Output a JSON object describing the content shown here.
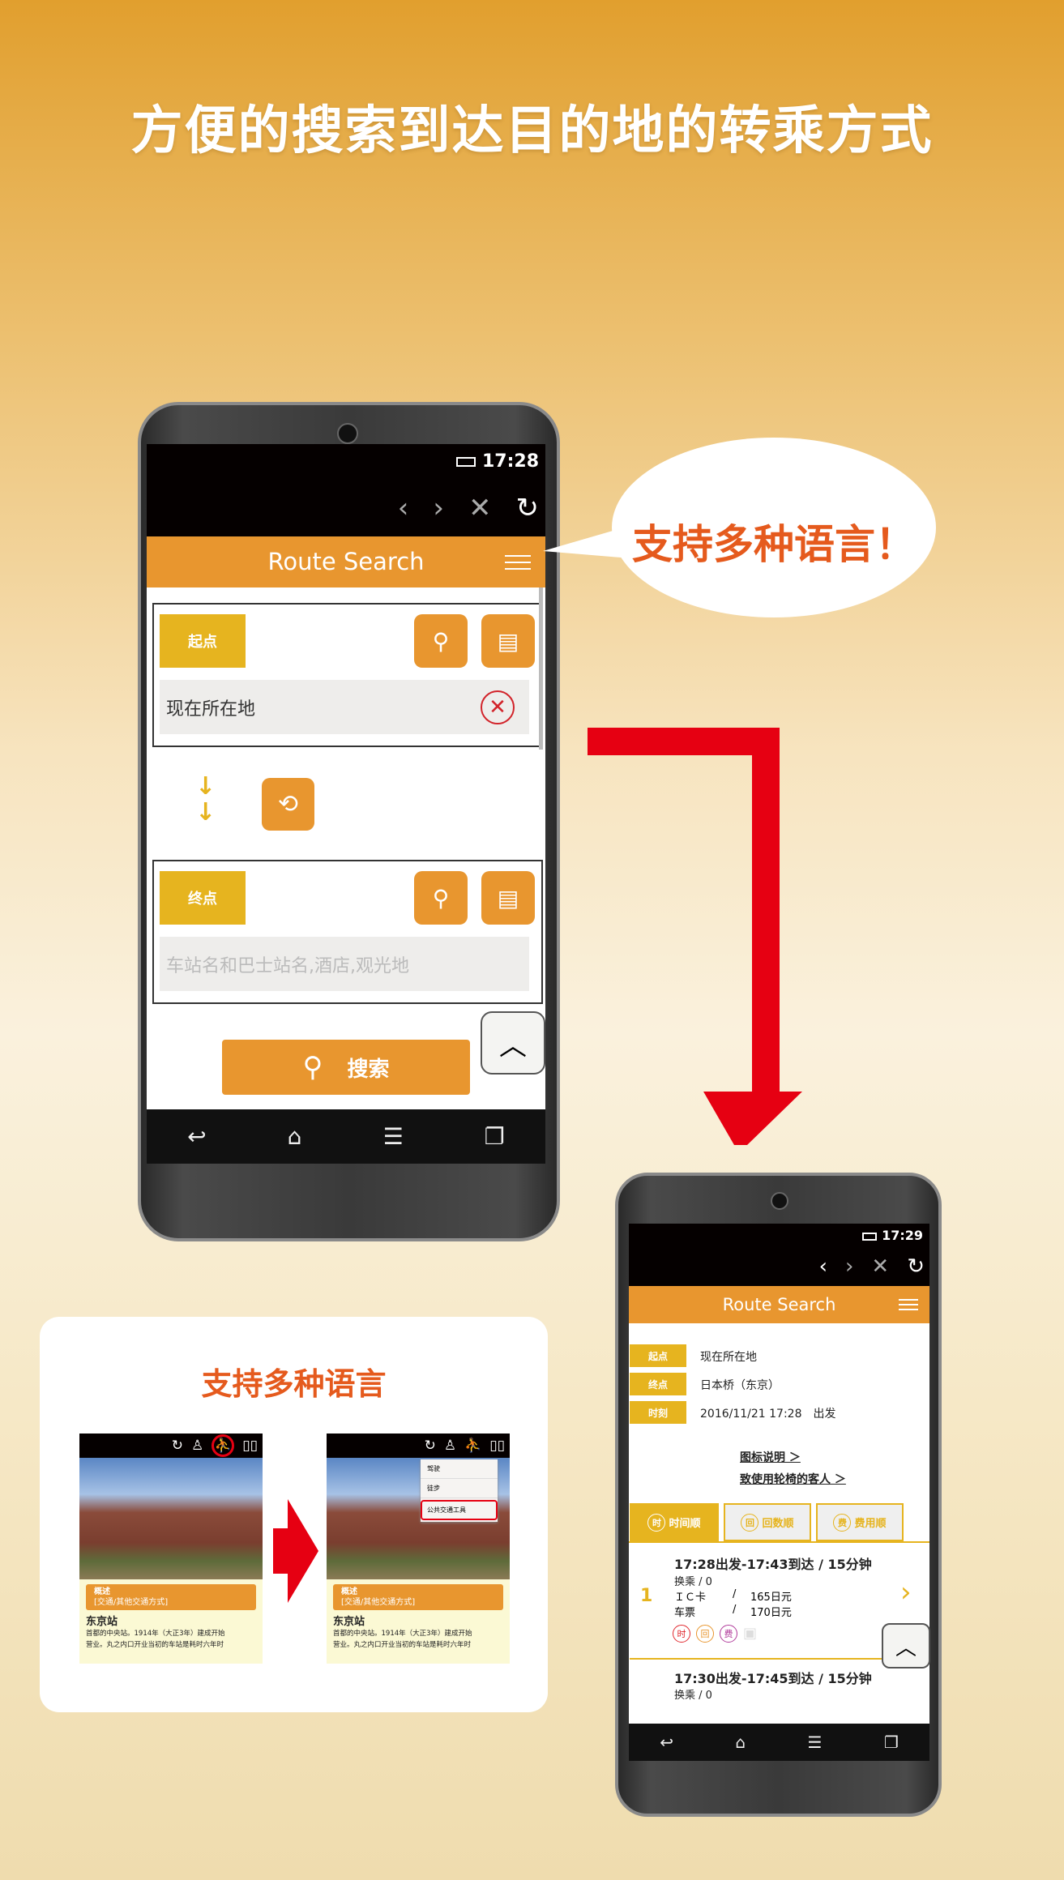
{
  "headline": "方便的搜索到达目的地的转乘方式",
  "callout": "支持多种语言！",
  "colors": {
    "accent": "#e8962f",
    "label": "#e6b41f",
    "red_arrow": "#e60012",
    "callout_text": "#e55a1d"
  },
  "phone1": {
    "status_time": "17:28",
    "nav_icons": [
      "chevron-left-icon",
      "chevron-right-icon",
      "close-icon",
      "refresh-icon"
    ],
    "header_title": "Route Search",
    "origin": {
      "label": "起点",
      "value": "现在所在地"
    },
    "destination": {
      "label": "终点",
      "placeholder": "车站名和巴士站名,酒店,观光地"
    },
    "search_label": "搜索",
    "bottom_nav": [
      "back-icon",
      "home-icon",
      "menu-icon",
      "windows-icon"
    ]
  },
  "phone2": {
    "status_time": "17:29",
    "header_title": "Route Search",
    "summary": [
      {
        "label": "起点",
        "value": "现在所在地"
      },
      {
        "label": "终点",
        "value": "日本桥（东京）"
      },
      {
        "label": "时刻",
        "value": "2016/11/21 17:28　出发"
      }
    ],
    "links": [
      "图标说明 ＞",
      "致使用轮椅的客人 ＞"
    ],
    "tabs": [
      {
        "icon": "时",
        "label": "时间顺",
        "active": true
      },
      {
        "icon": "回",
        "label": "回数顺",
        "active": false
      },
      {
        "icon": "费",
        "label": "费用顺",
        "active": false
      }
    ],
    "results": [
      {
        "num": "1",
        "title": "17:28出发-17:43到达 / 15分钟",
        "transfer": "换乘 / 0",
        "ic_label": "ＩＣ卡",
        "ic_fare": "165日元",
        "ticket_label": "车票",
        "ticket_fare": "170日元",
        "badges": [
          "时",
          "回",
          "费"
        ]
      },
      {
        "title": "17:30出发-17:45到达 / 15分钟",
        "transfer": "换乘 / 0"
      }
    ]
  },
  "card": {
    "title": "支持多种语言",
    "menu_items": [
      "驾驶",
      "徒步",
      "公共交通工具"
    ],
    "info_box": [
      "概述",
      "[交通/其他交通方式]"
    ],
    "place": "东京站",
    "desc": [
      "首都的中央站。1914年（大正3年）建成开始",
      "营业。丸之内口开业当初的车站是耗时六年时"
    ]
  }
}
